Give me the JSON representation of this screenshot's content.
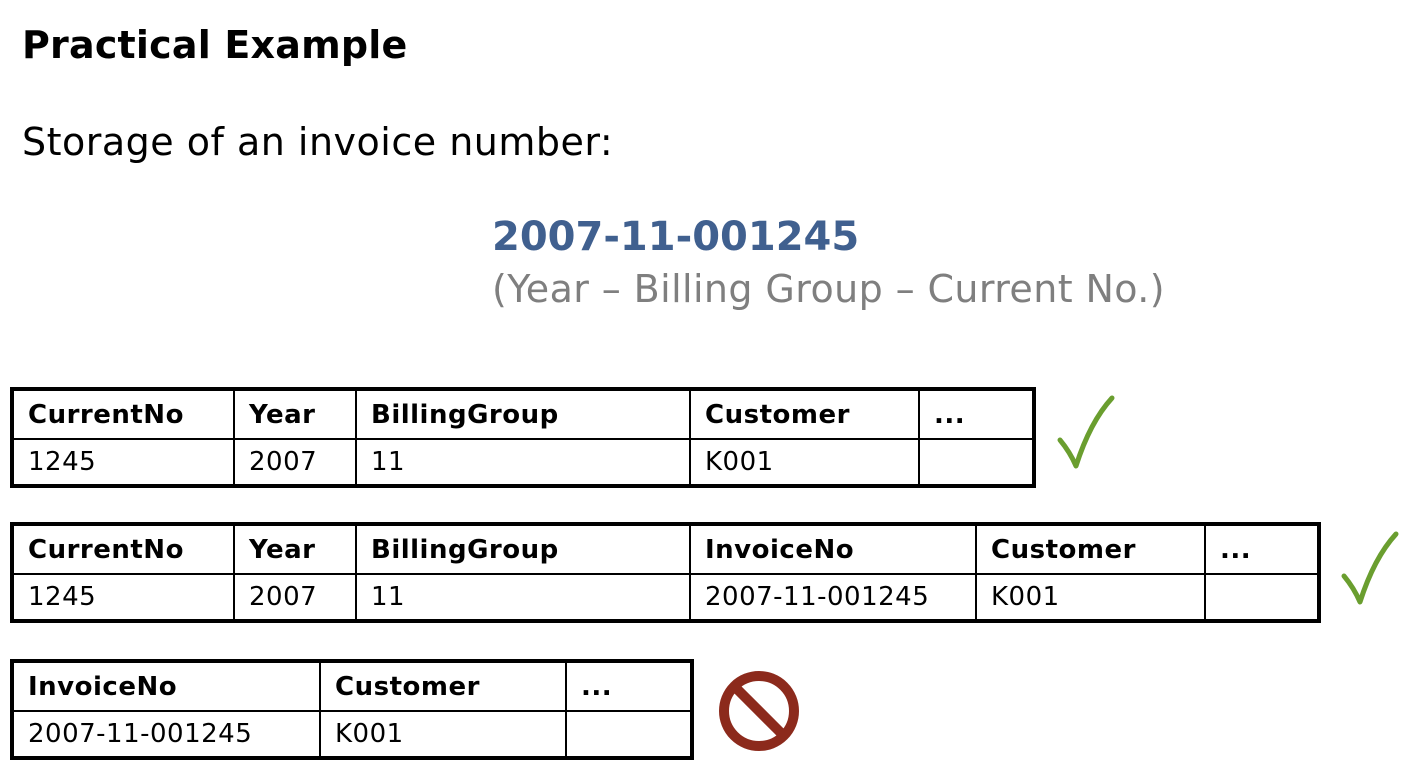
{
  "heading": "Practical Example",
  "intro": "Storage of an invoice number:",
  "invoice": {
    "number": "2007-11-001245",
    "legend": "(Year – Billing Group – Current No.)",
    "number_color": "#40608f",
    "legend_color": "#7f7f7f"
  },
  "tables": [
    {
      "verdict": "valid",
      "verdict_icon": "checkmark-icon",
      "columns": [
        "CurrentNo",
        "Year",
        "BillingGroup",
        "Customer",
        "..."
      ],
      "row": [
        "1245",
        "2007",
        "11",
        "K001",
        ""
      ]
    },
    {
      "verdict": "valid",
      "verdict_icon": "checkmark-icon",
      "columns": [
        "CurrentNo",
        "Year",
        "BillingGroup",
        "InvoiceNo",
        "Customer",
        "..."
      ],
      "row": [
        "1245",
        "2007",
        "11",
        "2007-11-001245",
        "K001",
        ""
      ]
    },
    {
      "verdict": "invalid",
      "verdict_icon": "prohibited-icon",
      "columns": [
        "InvoiceNo",
        "Customer",
        "..."
      ],
      "row": [
        "2007-11-001245",
        "K001",
        ""
      ]
    }
  ],
  "colors": {
    "check": "#6a9e2f",
    "prohibited": "#8c2a1c"
  }
}
